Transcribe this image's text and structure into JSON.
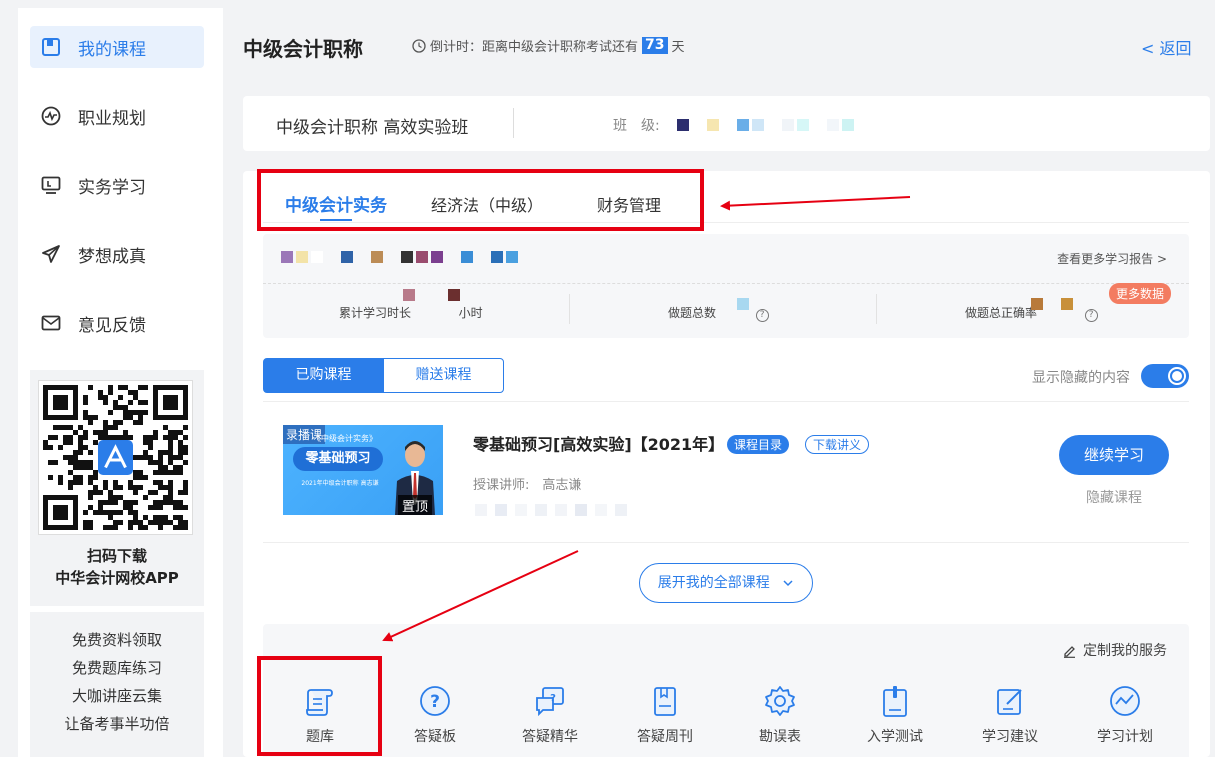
{
  "sidebar": {
    "items": [
      {
        "label": "我的课程",
        "icon": "book-icon"
      },
      {
        "label": "职业规划",
        "icon": "pulse-icon"
      },
      {
        "label": "实务学习",
        "icon": "monitor-icon"
      },
      {
        "label": "梦想成真",
        "icon": "paper-plane-icon"
      },
      {
        "label": "意见反馈",
        "icon": "mail-icon"
      }
    ],
    "qr_caption_1": "扫码下载",
    "qr_caption_2": "中华会计网校APP",
    "promo": [
      "免费资料领取",
      "免费题库练习",
      "大咖讲座云集",
      "让备考事半功倍"
    ]
  },
  "header": {
    "title": "中级会计职称",
    "countdown_prefix": "倒计时：距离中级会计职称考试还有",
    "countdown_days": "73",
    "countdown_suffix": "天",
    "back_label": "< 返回"
  },
  "classbar": {
    "class_name": "中级会计职称 高效实验班",
    "class_label": "班　级:"
  },
  "tabs": [
    {
      "label": "中级会计实务"
    },
    {
      "label": "经济法（中级）"
    },
    {
      "label": "财务管理"
    }
  ],
  "report": {
    "more_link": "查看更多学习报告 >",
    "stat_time_label": "累计学习时长",
    "stat_time_unit": "小时",
    "stat_questions_label": "做题总数",
    "stat_accuracy_label": "做题总正确率",
    "more_data_badge": "更多数据"
  },
  "course_filter": {
    "purchased": "已购课程",
    "gifted": "赠送课程",
    "show_hidden_label": "显示隐藏的内容",
    "show_hidden_on": true
  },
  "course": {
    "badge": "录播课",
    "thumb_subtitle": "《中级会计实务》",
    "thumb_title": "零基础预习",
    "thumb_small": "2021年中级会计职称 高志谦",
    "pin_label": "置顶",
    "title": "零基础预习[高效实验]【2021年】",
    "tag_catalog": "课程目录",
    "tag_handout": "下载讲义",
    "lecturer": "授课讲师:　高志谦",
    "continue_label": "继续学习",
    "hide_label": "隐藏课程"
  },
  "expand_label": "展开我的全部课程",
  "services": {
    "custom_link": "定制我的服务",
    "items": [
      {
        "label": "题库",
        "icon": "scroll-icon"
      },
      {
        "label": "答疑板",
        "icon": "question-circle-icon"
      },
      {
        "label": "答疑精华",
        "icon": "chat-question-icon"
      },
      {
        "label": "答疑周刊",
        "icon": "notebook-icon"
      },
      {
        "label": "勘误表",
        "icon": "gear-icon"
      },
      {
        "label": "入学测试",
        "icon": "clipboard-icon"
      },
      {
        "label": "学习建议",
        "icon": "edit-icon"
      },
      {
        "label": "学习计划",
        "icon": "chart-circle-icon"
      }
    ]
  },
  "colors": {
    "accent": "#2b7de9",
    "highlight": "#e60012",
    "badge_orange": "#f37c61"
  }
}
